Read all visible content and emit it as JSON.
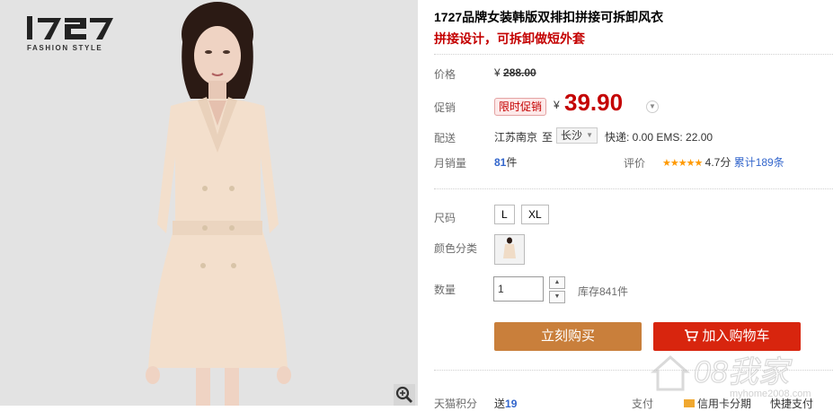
{
  "brand": {
    "logo_text": "1727",
    "tagline": "FASHION STYLE"
  },
  "product": {
    "title": "1727品牌女装韩版双排扣拼接可拆卸风衣",
    "subtitle": "拼接设计，可拆卸做短外套"
  },
  "price": {
    "label": "价格",
    "currency": "¥",
    "original": "288.00"
  },
  "promo": {
    "label": "促销",
    "badge": "限时促销",
    "currency": "¥",
    "price": "39.90"
  },
  "shipping": {
    "label": "配送",
    "from": "江苏南京",
    "to_word": "至",
    "city": "长沙",
    "fees": "快递: 0.00 EMS: 22.00"
  },
  "sales": {
    "label": "月销量",
    "count": "81",
    "unit": "件",
    "rating_label": "评价",
    "stars": "★★★★★",
    "score": "4.7分",
    "reviews_prefix": "累计",
    "reviews_count": "189",
    "reviews_suffix": "条"
  },
  "options": {
    "size_label": "尺码",
    "sizes": [
      "L",
      "XL"
    ],
    "color_label": "颜色分类",
    "qty_label": "数量",
    "qty_value": "1",
    "stock": "库存841件"
  },
  "actions": {
    "buy_now": "立刻购买",
    "add_to_cart": "加入购物车"
  },
  "footer": {
    "points_label": "天猫积分",
    "points_prefix": "送",
    "points_value": "19",
    "pay_label": "支付",
    "credit": "信用卡分期",
    "quick_pay": "快捷支付"
  },
  "watermark": {
    "text": "08我家",
    "url_text": "myhome2008.com"
  },
  "colors": {
    "accent_red": "#c40000",
    "buy_orange": "#c97f3b",
    "cart_red": "#d8250e",
    "link_blue": "#3366cc",
    "star_orange": "#ff9900"
  },
  "icons": [
    "zoom-icon",
    "cart-icon",
    "chevron-down-icon",
    "credit-card-icon",
    "home-icon"
  ]
}
